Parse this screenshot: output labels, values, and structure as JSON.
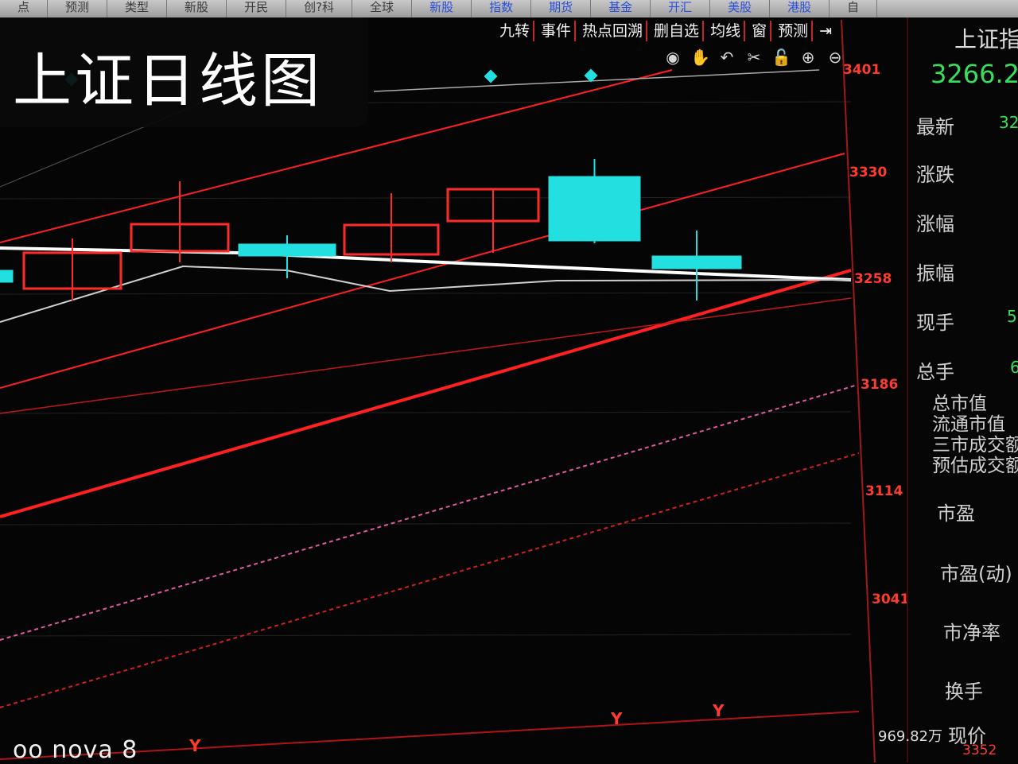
{
  "top_tabs": [
    "点",
    "预测",
    "类型",
    "新股",
    "开民",
    "创?科",
    "全球",
    "新股",
    "指数",
    "期货",
    "基金",
    "开汇",
    "美股",
    "港股",
    "自"
  ],
  "title_overlay": "上证日线图",
  "tool_buttons": [
    "九转",
    "事件",
    "热点回溯",
    "删自选",
    "均线",
    "窗",
    "预测"
  ],
  "icons": [
    "eye-icon",
    "hand-icon",
    "undo-icon",
    "scissors-icon",
    "lock-icon",
    "zoom-in-icon",
    "zoom-out-icon"
  ],
  "price_axis": [
    "3401",
    "3330",
    "3258",
    "3186",
    "3114",
    "3041"
  ],
  "side_panel": {
    "title": "上证指",
    "price": "3266.2",
    "rows": [
      {
        "label": "最新",
        "value": "32"
      },
      {
        "label": "涨跌",
        "value": ""
      },
      {
        "label": "涨幅",
        "value": ""
      },
      {
        "label": "振幅",
        "value": ""
      },
      {
        "label": "现手",
        "value": "5"
      },
      {
        "label": "总手",
        "value": "6"
      }
    ],
    "market_labels": [
      "总市值",
      "流通市值",
      "三市成交额",
      "预估成交额"
    ],
    "ratios": [
      "市盈",
      "市盈(动)",
      "市净率",
      "换手"
    ],
    "bottom_label": "现价"
  },
  "bottom_volume": "969.82万",
  "bottom_price": "3352",
  "markers": [
    "Y",
    "Y",
    "Y"
  ],
  "watermark": "oo nova 8",
  "colors": {
    "up": "#ff2a2a",
    "down": "#22e0e0",
    "ma_white": "#ffffff",
    "trend_red": "#ff2020",
    "dash_pink": "#e05aa0"
  }
}
